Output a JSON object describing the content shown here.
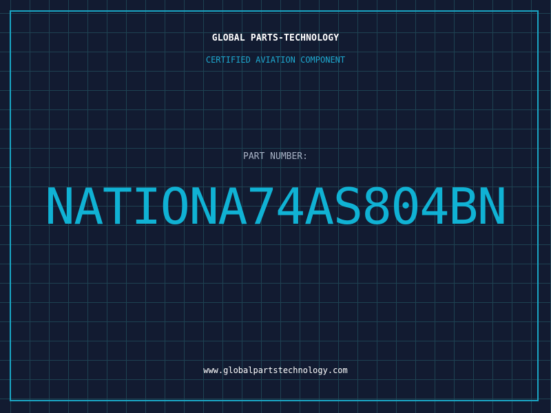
{
  "header": {
    "brand": "GLOBAL PARTS-TECHNOLOGY",
    "subtitle": "CERTIFIED AVIATION COMPONENT"
  },
  "part": {
    "label": "PART NUMBER:",
    "number": "NATIONA74AS804BN"
  },
  "footer": {
    "url": "www.globalpartstechnology.com"
  },
  "colors": {
    "background": "#121b31",
    "grid": "#1e4252",
    "accent": "#1aa6c4",
    "part_number": "#10b2d4"
  }
}
